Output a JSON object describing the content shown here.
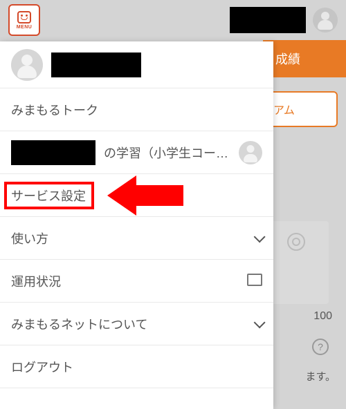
{
  "header": {
    "menu_label": "MENU"
  },
  "background": {
    "tab_label": "成績",
    "outline_button_fragment": "アム",
    "value": "100",
    "help_char": "?",
    "text_fragment": "ます。"
  },
  "menu": {
    "items": [
      {
        "kind": "profile"
      },
      {
        "kind": "item",
        "label": "みまもるトーク"
      },
      {
        "kind": "learning",
        "label_suffix": "の学習（小学生コー…"
      },
      {
        "kind": "highlighted",
        "label": "サービス設定"
      },
      {
        "kind": "item_expand",
        "label": "使い方"
      },
      {
        "kind": "item_external",
        "label": "運用状況"
      },
      {
        "kind": "item_expand",
        "label": "みまもるネットについて"
      },
      {
        "kind": "item",
        "label": "ログアウト"
      }
    ]
  }
}
